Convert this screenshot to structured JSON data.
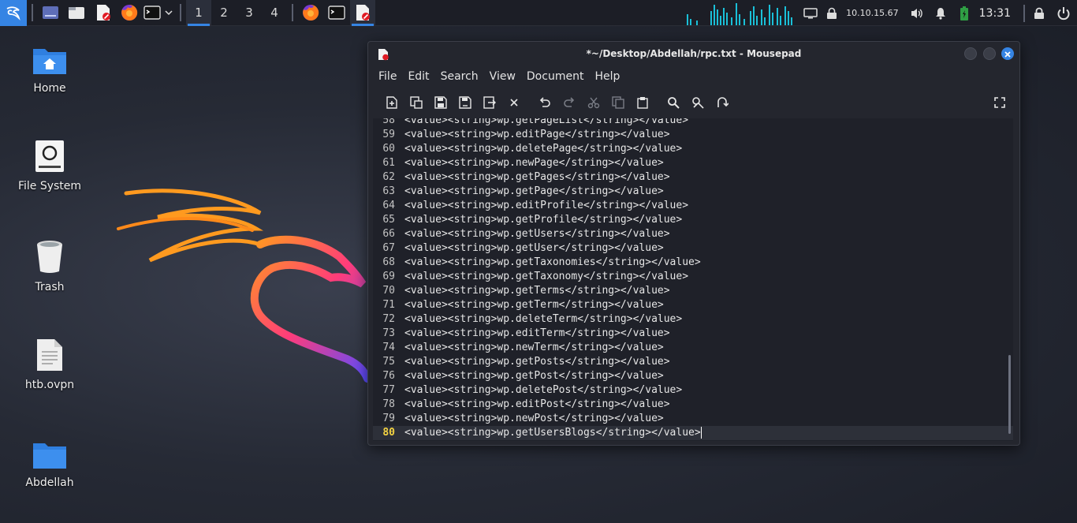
{
  "panel": {
    "workspaces": [
      "1",
      "2",
      "3",
      "4"
    ],
    "ip_address": "10.10.15.67",
    "clock": "13:31"
  },
  "desktop": {
    "icons": [
      {
        "label": "Home",
        "icon": "folder-home-icon"
      },
      {
        "label": "File System",
        "icon": "drive-icon"
      },
      {
        "label": "Trash",
        "icon": "trash-icon"
      },
      {
        "label": "htb.ovpn",
        "icon": "text-file-icon"
      },
      {
        "label": "Abdellah",
        "icon": "folder-icon"
      }
    ]
  },
  "window": {
    "title": "*~/Desktop/Abdellah/rpc.txt - Mousepad",
    "menu": [
      "File",
      "Edit",
      "Search",
      "View",
      "Document",
      "Help"
    ],
    "lines": [
      {
        "n": "58",
        "text": "<value><string>wp.getPageList</string></value>"
      },
      {
        "n": "59",
        "text": "<value><string>wp.editPage</string></value>"
      },
      {
        "n": "60",
        "text": "<value><string>wp.deletePage</string></value>"
      },
      {
        "n": "61",
        "text": "<value><string>wp.newPage</string></value>"
      },
      {
        "n": "62",
        "text": "<value><string>wp.getPages</string></value>"
      },
      {
        "n": "63",
        "text": "<value><string>wp.getPage</string></value>"
      },
      {
        "n": "64",
        "text": "<value><string>wp.editProfile</string></value>"
      },
      {
        "n": "65",
        "text": "<value><string>wp.getProfile</string></value>"
      },
      {
        "n": "66",
        "text": "<value><string>wp.getUsers</string></value>"
      },
      {
        "n": "67",
        "text": "<value><string>wp.getUser</string></value>"
      },
      {
        "n": "68",
        "text": "<value><string>wp.getTaxonomies</string></value>"
      },
      {
        "n": "69",
        "text": "<value><string>wp.getTaxonomy</string></value>"
      },
      {
        "n": "70",
        "text": "<value><string>wp.getTerms</string></value>"
      },
      {
        "n": "71",
        "text": "<value><string>wp.getTerm</string></value>"
      },
      {
        "n": "72",
        "text": "<value><string>wp.deleteTerm</string></value>"
      },
      {
        "n": "73",
        "text": "<value><string>wp.editTerm</string></value>"
      },
      {
        "n": "74",
        "text": "<value><string>wp.newTerm</string></value>"
      },
      {
        "n": "75",
        "text": "<value><string>wp.getPosts</string></value>"
      },
      {
        "n": "76",
        "text": "<value><string>wp.getPost</string></value>"
      },
      {
        "n": "77",
        "text": "<value><string>wp.deletePost</string></value>"
      },
      {
        "n": "78",
        "text": "<value><string>wp.editPost</string></value>"
      },
      {
        "n": "79",
        "text": "<value><string>wp.newPost</string></value>"
      },
      {
        "n": "80",
        "text": "<value><string>wp.getUsersBlogs</string></value>"
      }
    ]
  },
  "colors": {
    "accent": "#3584e4",
    "current_line_number": "#f5d442"
  }
}
